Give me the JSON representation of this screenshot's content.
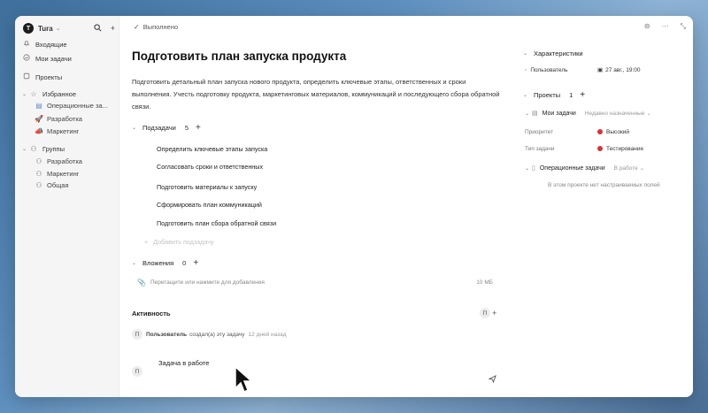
{
  "sidebar": {
    "workspace": {
      "logo": "Т",
      "name": "Tura"
    },
    "top_items": [
      {
        "label": "Входящие",
        "icon": "bell-icon"
      },
      {
        "label": "Мои задачи",
        "icon": "check-circle-icon"
      },
      {
        "label": "Проекты",
        "icon": "folder-icon"
      }
    ],
    "favorites": {
      "label": "Избранное",
      "items": [
        {
          "label": "Операционные за..."
        },
        {
          "label": "Разработка"
        },
        {
          "label": "Маркетинг"
        }
      ]
    },
    "groups": {
      "label": "Группы",
      "items": [
        {
          "label": "Разработка"
        },
        {
          "label": "Маркетинг"
        },
        {
          "label": "Общая"
        }
      ]
    }
  },
  "main": {
    "status": "Выполнено",
    "title": "Подготовить план запуска продукта",
    "description": "Подготовить детальный план запуска нового продукта, определить ключевые этапы, ответственных и сроки выполнения. Учесть подготовку продукта, маркетинговых материалов, коммуникаций и последующего сбора обратной связи.",
    "subtasks": {
      "label": "Подзадачи",
      "count": "5",
      "items": [
        "Определить ключевые этапы запуска",
        "Согласовать сроки и ответственных",
        "Подготовить материалы к запуску",
        "Сформировать план коммуникаций",
        "Подготовить план сбора обратной связи"
      ],
      "add_label": "Добавить подзадачу"
    },
    "attachments": {
      "label": "Вложения",
      "count": "0",
      "drop_text": "Перетащите или нажмите для добавления",
      "max_size": "10 МБ"
    },
    "activity": {
      "label": "Активность",
      "avatar": "П",
      "entry": {
        "avatar": "П",
        "who": "Пользователь",
        "action": "создал(а) эту задачу",
        "time": "12 дней назад"
      },
      "comment": {
        "avatar": "П",
        "text": "Задача в работе"
      }
    }
  },
  "right": {
    "characteristics": {
      "label": "Характеристики",
      "assignee": "Пользователь",
      "due": "27 авг., 19:00"
    },
    "projects": {
      "label": "Проекты",
      "count": "1",
      "my_tasks": {
        "label": "Мои задачи",
        "status": "Недавно назначенные",
        "priority_key": "Приоритет",
        "priority_value": "Высокий",
        "type_key": "Тип задачи",
        "type_value": "Тестирование"
      },
      "ops": {
        "label": "Операционные задачи",
        "status": "В работе",
        "empty_note": "В этом проекте нет настраиваемых полей"
      }
    }
  },
  "colors": {
    "priority_high": "#d7323f",
    "type_testing": "#d7323f",
    "due_date": "#c4323c"
  }
}
